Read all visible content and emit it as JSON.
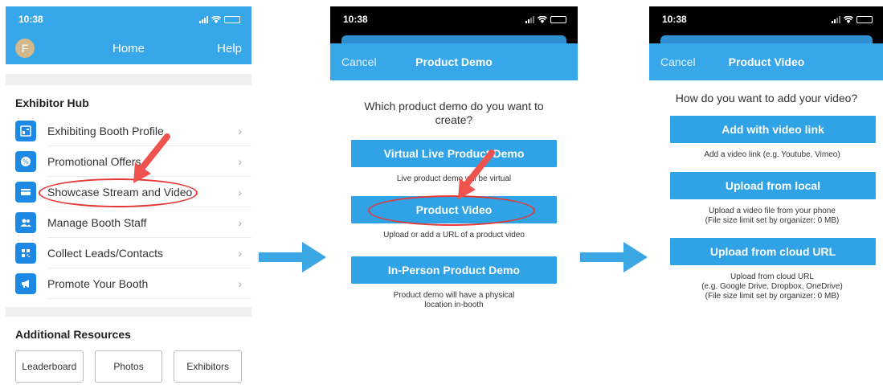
{
  "status_time": "10:38",
  "phone1": {
    "header": {
      "avatar_letter": "F",
      "title": "Home",
      "help": "Help"
    },
    "section_title": "Exhibitor Hub",
    "items": [
      {
        "label": "Exhibiting Booth Profile",
        "icon": "booth-profile-icon"
      },
      {
        "label": "Promotional Offers",
        "icon": "promo-icon"
      },
      {
        "label": "Showcase Stream and Video",
        "icon": "video-stream-icon"
      },
      {
        "label": "Manage Booth Staff",
        "icon": "staff-icon"
      },
      {
        "label": "Collect Leads/Contacts",
        "icon": "qr-code-icon"
      },
      {
        "label": "Promote Your Booth",
        "icon": "megaphone-icon"
      }
    ],
    "resources_title": "Additional Resources",
    "resource_buttons": [
      "Leaderboard",
      "Photos",
      "Exhibitors"
    ]
  },
  "phone2": {
    "cancel": "Cancel",
    "title": "Product Demo",
    "question": "Which product demo do you want to create?",
    "options": [
      {
        "label": "Virtual Live Product Demo",
        "caption": "Live product demo will be virtual"
      },
      {
        "label": "Product Video",
        "caption": "Upload or add a URL of a product video"
      },
      {
        "label": "In-Person Product Demo",
        "caption": "Product demo will have a physical location in-booth"
      }
    ]
  },
  "phone3": {
    "cancel": "Cancel",
    "title": "Product Video",
    "question": "How do you want to add your video?",
    "options": [
      {
        "label": "Add with video link",
        "caption": "Add a video link (e.g. Youtube, Vimeo)"
      },
      {
        "label": "Upload from local",
        "caption": "Upload a video file from your phone\n(File size limit set by organizer: 0 MB)"
      },
      {
        "label": "Upload from cloud URL",
        "caption": "Upload from cloud URL\n(e.g. Google Drive, Dropbox, OneDrive)\n(File size limit set by organizer: 0 MB)"
      }
    ]
  },
  "colors": {
    "header_blue": "#37a7ea",
    "button_blue": "#2fa3e6",
    "icon_blue": "#1e88e5",
    "flow_arrow": "#3aa7e4",
    "annotation_red": "#e53935"
  }
}
